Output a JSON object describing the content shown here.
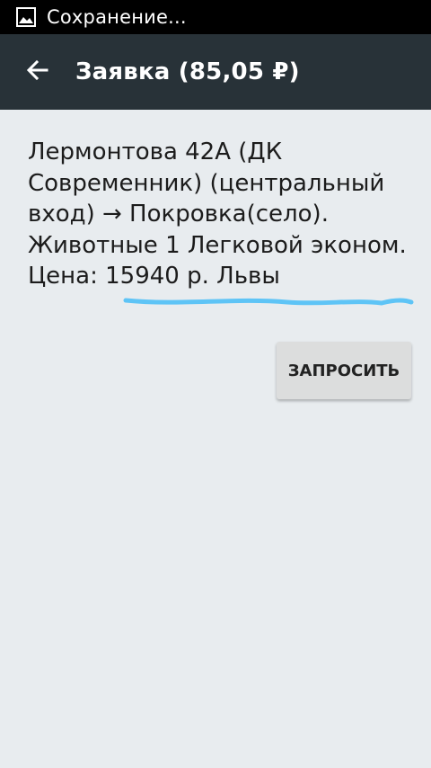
{
  "status_bar": {
    "icon": "image-icon",
    "text": "Сохранение..."
  },
  "app_bar": {
    "back_icon": "arrow-left-icon",
    "title": "Заявка (85,05 ₽)"
  },
  "request": {
    "description": "Лермонтова 42А (ДК Современник) (центральный вход) → Покровка(село). Животные 1 Легковой эконом. Цена: 15940 р. Львы",
    "highlight_color": "#5ec4f6"
  },
  "actions": {
    "request_label": "ЗАПРОСИТЬ"
  },
  "colors": {
    "status_bar": "#000000",
    "app_bar": "#283238",
    "background": "#e8ecef",
    "button": "#dcdddd"
  }
}
